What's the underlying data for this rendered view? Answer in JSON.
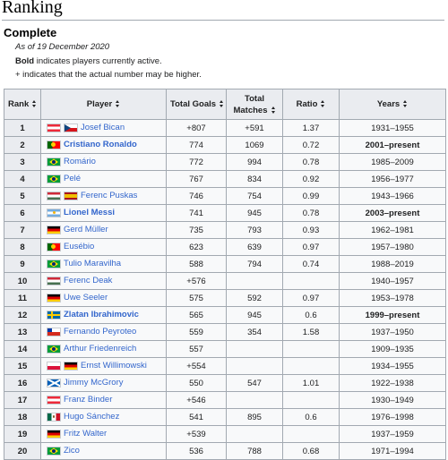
{
  "section": {
    "title": "Ranking"
  },
  "subsection": {
    "title": "Complete"
  },
  "notes": {
    "as_of": "As of 19 December 2020",
    "bold_word": "Bold",
    "bold_rest": " indicates players currently active.",
    "plus": "+ indicates that the actual number may be higher."
  },
  "table": {
    "headers": {
      "rank": "Rank",
      "player": "Player",
      "total_goals": "Total Goals",
      "total_matches_1": "Total",
      "total_matches_2": "Matches",
      "ratio": "Ratio",
      "years": "Years"
    },
    "rows": [
      {
        "rank": "1",
        "flags": [
          "austria",
          "czechia"
        ],
        "player": "Josef Bican",
        "active": false,
        "goals": "+807",
        "matches": "+591",
        "ratio": "1.37",
        "years": "1931–1955"
      },
      {
        "rank": "2",
        "flags": [
          "portugal"
        ],
        "player": "Cristiano Ronaldo",
        "active": true,
        "goals": "774",
        "matches": "1069",
        "ratio": "0.72",
        "years": "2001–present"
      },
      {
        "rank": "3",
        "flags": [
          "brazil"
        ],
        "player": "Romário",
        "active": false,
        "goals": "772",
        "matches": "994",
        "ratio": "0.78",
        "years": "1985–2009"
      },
      {
        "rank": "4",
        "flags": [
          "brazil"
        ],
        "player": "Pelé",
        "active": false,
        "goals": "767",
        "matches": "834",
        "ratio": "0.92",
        "years": "1956–1977"
      },
      {
        "rank": "5",
        "flags": [
          "hungary",
          "spain"
        ],
        "player": "Ferenc Puskas",
        "active": false,
        "goals": "746",
        "matches": "754",
        "ratio": "0.99",
        "years": "1943–1966"
      },
      {
        "rank": "6",
        "flags": [
          "argentina"
        ],
        "player": "Lionel Messi",
        "active": true,
        "goals": "741",
        "matches": "945",
        "ratio": "0.78",
        "years": "2003–present"
      },
      {
        "rank": "7",
        "flags": [
          "germany"
        ],
        "player": "Gerd Müller",
        "active": false,
        "goals": "735",
        "matches": "793",
        "ratio": "0.93",
        "years": "1962–1981"
      },
      {
        "rank": "8",
        "flags": [
          "portugal"
        ],
        "player": "Eusébio",
        "active": false,
        "goals": "623",
        "matches": "639",
        "ratio": "0.97",
        "years": "1957–1980"
      },
      {
        "rank": "9",
        "flags": [
          "brazil"
        ],
        "player": "Tulio Maravilha",
        "active": false,
        "goals": "588",
        "matches": "794",
        "ratio": "0.74",
        "years": "1988–2019"
      },
      {
        "rank": "10",
        "flags": [
          "hungary"
        ],
        "player": "Ferenc Deak",
        "active": false,
        "goals": "+576",
        "matches": "",
        "ratio": "",
        "years": "1940–1957"
      },
      {
        "rank": "11",
        "flags": [
          "germany"
        ],
        "player": "Uwe Seeler",
        "active": false,
        "goals": "575",
        "matches": "592",
        "ratio": "0.97",
        "years": "1953–1978"
      },
      {
        "rank": "12",
        "flags": [
          "sweden"
        ],
        "player": "Zlatan Ibrahimovic",
        "active": true,
        "goals": "565",
        "matches": "945",
        "ratio": "0.6",
        "years": "1999–present"
      },
      {
        "rank": "13",
        "flags": [
          "chile"
        ],
        "player": "Fernando Peyroteo",
        "active": false,
        "goals": "559",
        "matches": "354",
        "ratio": "1.58",
        "years": "1937–1950"
      },
      {
        "rank": "14",
        "flags": [
          "brazil"
        ],
        "player": "Arthur Friedenreich",
        "active": false,
        "goals": "557",
        "matches": "",
        "ratio": "",
        "years": "1909–1935"
      },
      {
        "rank": "15",
        "flags": [
          "poland",
          "germany"
        ],
        "player": "Ernst Willimowski",
        "active": false,
        "goals": "+554",
        "matches": "",
        "ratio": "",
        "years": "1934–1955"
      },
      {
        "rank": "16",
        "flags": [
          "scotland"
        ],
        "player": "Jimmy McGrory",
        "active": false,
        "goals": "550",
        "matches": "547",
        "ratio": "1.01",
        "years": "1922–1938"
      },
      {
        "rank": "17",
        "flags": [
          "austria"
        ],
        "player": "Franz Binder",
        "active": false,
        "goals": "+546",
        "matches": "",
        "ratio": "",
        "years": "1930–1949"
      },
      {
        "rank": "18",
        "flags": [
          "mexico"
        ],
        "player": "Hugo Sánchez",
        "active": false,
        "goals": "541",
        "matches": "895",
        "ratio": "0.6",
        "years": "1976–1998"
      },
      {
        "rank": "19",
        "flags": [
          "germany"
        ],
        "player": "Fritz Walter",
        "active": false,
        "goals": "+539",
        "matches": "",
        "ratio": "",
        "years": "1937–1959"
      },
      {
        "rank": "20",
        "flags": [
          "brazil"
        ],
        "player": "Zico",
        "active": false,
        "goals": "536",
        "matches": "788",
        "ratio": "0.68",
        "years": "1971–1994"
      }
    ]
  },
  "colors": {
    "link": "#3366cc",
    "header_bg": "#eaecf0",
    "cell_bg": "#f8f9fa",
    "border": "#a2a9b1"
  }
}
